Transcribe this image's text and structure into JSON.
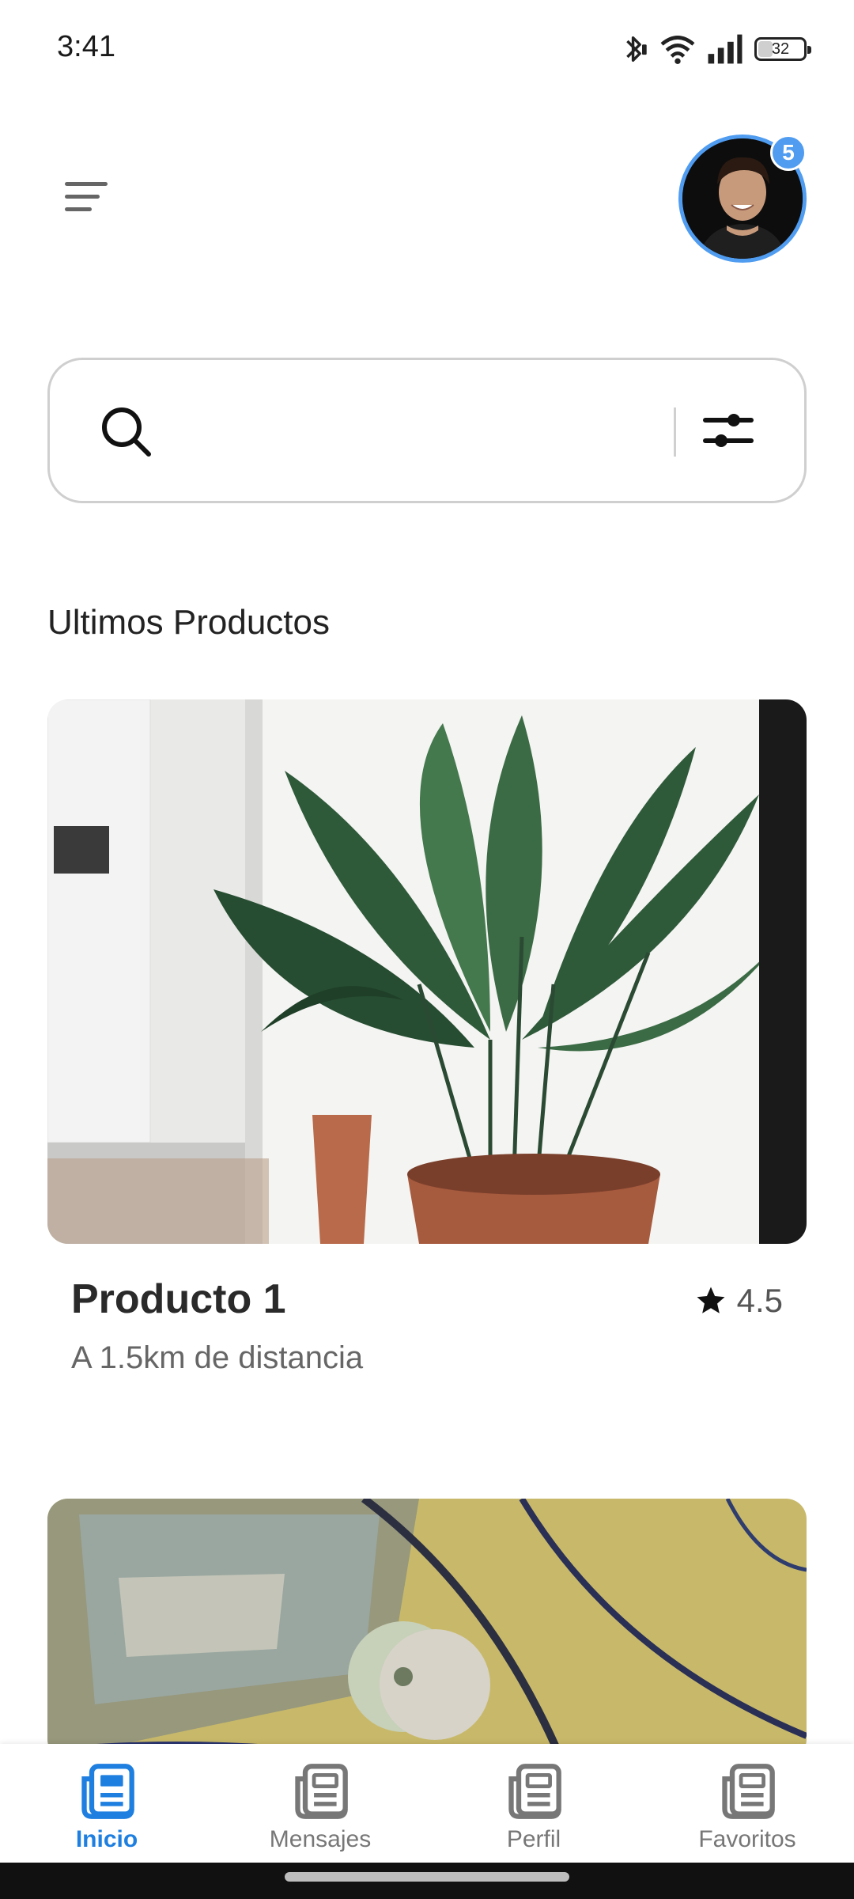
{
  "status_bar": {
    "time": "3:41",
    "battery": "32",
    "battery_level_percent": 32
  },
  "header": {
    "notification_count": "5"
  },
  "search": {
    "placeholder": ""
  },
  "section": {
    "title": "Ultimos Productos"
  },
  "products": [
    {
      "name": "Producto 1",
      "distance": "A 1.5km de distancia",
      "rating": "4.5"
    }
  ],
  "nav": {
    "items": [
      {
        "label": "Inicio",
        "icon": "newspaper-icon",
        "active": true
      },
      {
        "label": "Mensajes",
        "icon": "newspaper-icon",
        "active": false
      },
      {
        "label": "Perfil",
        "icon": "newspaper-icon",
        "active": false
      },
      {
        "label": "Favoritos",
        "icon": "newspaper-icon",
        "active": false
      }
    ]
  },
  "colors": {
    "accent": "#1e7fe0",
    "badge": "#4f9cf0",
    "inactive": "#777777"
  }
}
